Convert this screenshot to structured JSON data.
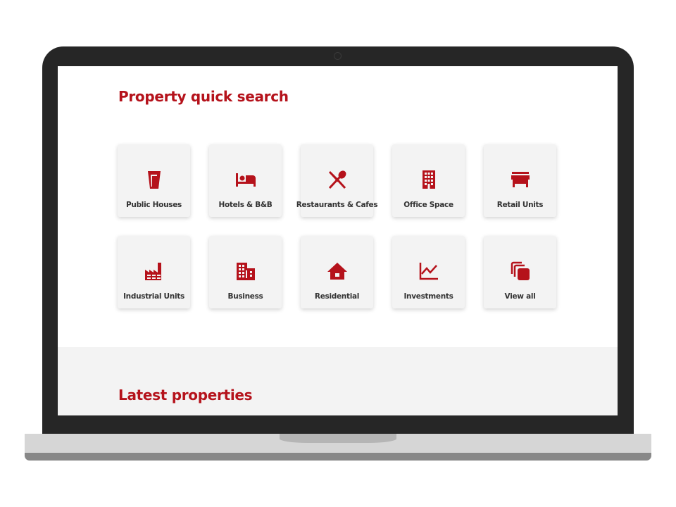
{
  "colors": {
    "accent": "#b5121b",
    "card_bg": "#f3f3f3",
    "bezel": "#262626",
    "label": "#333333"
  },
  "quick_search": {
    "title": "Property quick search",
    "categories": [
      {
        "label": "Public Houses",
        "icon": "pint-glass-icon"
      },
      {
        "label": "Hotels & B&B",
        "icon": "bed-icon"
      },
      {
        "label": "Restaurants & Cafes",
        "icon": "cutlery-icon"
      },
      {
        "label": "Office Space",
        "icon": "office-building-icon"
      },
      {
        "label": "Retail Units",
        "icon": "storefront-icon"
      },
      {
        "label": "Industrial Units",
        "icon": "factory-icon"
      },
      {
        "label": "Business",
        "icon": "business-building-icon"
      },
      {
        "label": "Residential",
        "icon": "house-icon"
      },
      {
        "label": "Investments",
        "icon": "line-chart-icon"
      },
      {
        "label": "View all",
        "icon": "stacked-squares-icon"
      }
    ]
  },
  "latest": {
    "title": "Latest properties"
  }
}
